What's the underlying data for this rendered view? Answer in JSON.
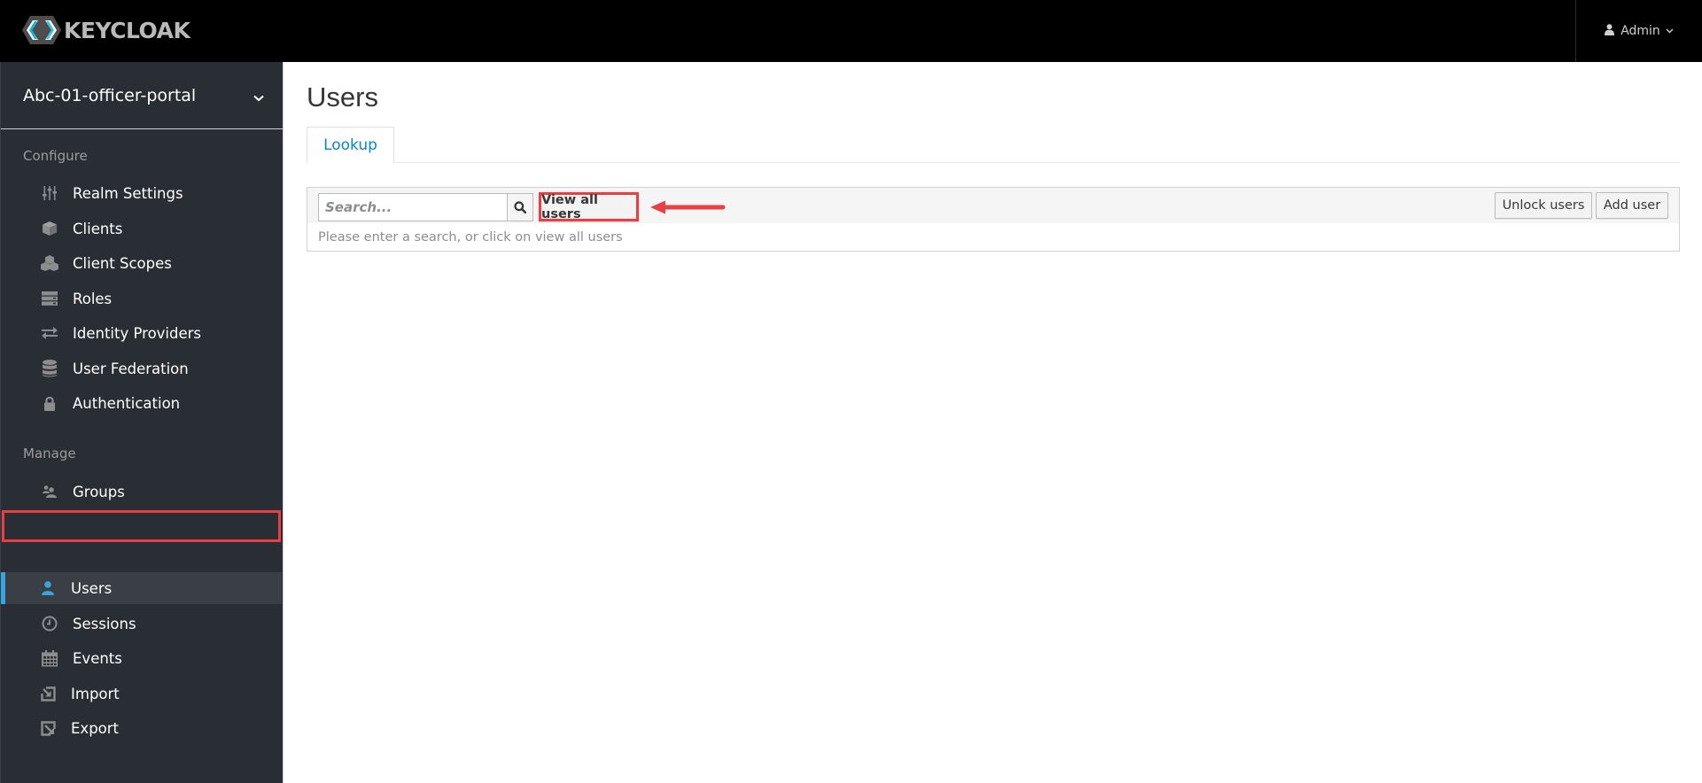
{
  "header": {
    "brand": "KEYCLOAK",
    "user_label": "Admin",
    "user_icon": "user-icon",
    "chevron_icon": "chevron-down-icon"
  },
  "sidebar": {
    "realm_name": "Abc-01-officer-portal",
    "sections": [
      {
        "label": "Configure",
        "items": [
          {
            "label": "Realm Settings",
            "icon": "sliders-icon",
            "active": false
          },
          {
            "label": "Clients",
            "icon": "cube-icon",
            "active": false
          },
          {
            "label": "Client Scopes",
            "icon": "cubes-icon",
            "active": false
          },
          {
            "label": "Roles",
            "icon": "server-icon",
            "active": false
          },
          {
            "label": "Identity Providers",
            "icon": "exchange-icon",
            "active": false
          },
          {
            "label": "User Federation",
            "icon": "database-icon",
            "active": false
          },
          {
            "label": "Authentication",
            "icon": "lock-icon",
            "active": false
          }
        ]
      },
      {
        "label": "Manage",
        "items": [
          {
            "label": "Groups",
            "icon": "users-icon",
            "active": false
          },
          {
            "label": "Users",
            "icon": "user-icon",
            "active": true
          },
          {
            "label": "Sessions",
            "icon": "clock-icon",
            "active": false
          },
          {
            "label": "Events",
            "icon": "calendar-icon",
            "active": false
          },
          {
            "label": "Import",
            "icon": "import-icon",
            "active": false
          },
          {
            "label": "Export",
            "icon": "export-icon",
            "active": false
          }
        ]
      }
    ]
  },
  "main": {
    "title": "Users",
    "tabs": [
      {
        "label": "Lookup",
        "active": true
      }
    ],
    "toolbar": {
      "search_placeholder": "Search...",
      "search_value": "",
      "view_all_label": "View all users",
      "unlock_label": "Unlock users",
      "add_user_label": "Add user"
    },
    "hint": "Please enter a search, or click on view all users"
  },
  "colors": {
    "header_bg": "#000000",
    "sidebar_bg": "#292e34",
    "active_accent": "#39a5dc",
    "link_blue": "#0088ce",
    "annotation_red": "#ea3e44"
  }
}
